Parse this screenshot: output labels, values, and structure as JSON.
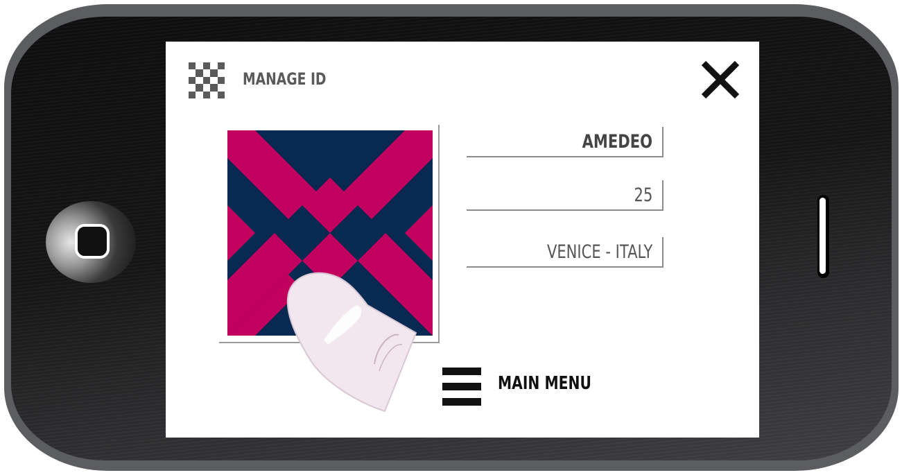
{
  "screen": {
    "title": "MANAGE ID",
    "header_icon": "checkerboard-icon",
    "close_icon": "close-icon"
  },
  "profile": {
    "name": "AMEDEO",
    "age": "25",
    "location": "VENICE - ITALY"
  },
  "id_pattern": {
    "colors": {
      "primary": "#c2005e",
      "background": "#072a52"
    }
  },
  "menu": {
    "icon": "hamburger-icon",
    "label": "MAIN MENU"
  },
  "device": {
    "body_color": "#5c5d60",
    "home_button_icon": "home-button"
  }
}
